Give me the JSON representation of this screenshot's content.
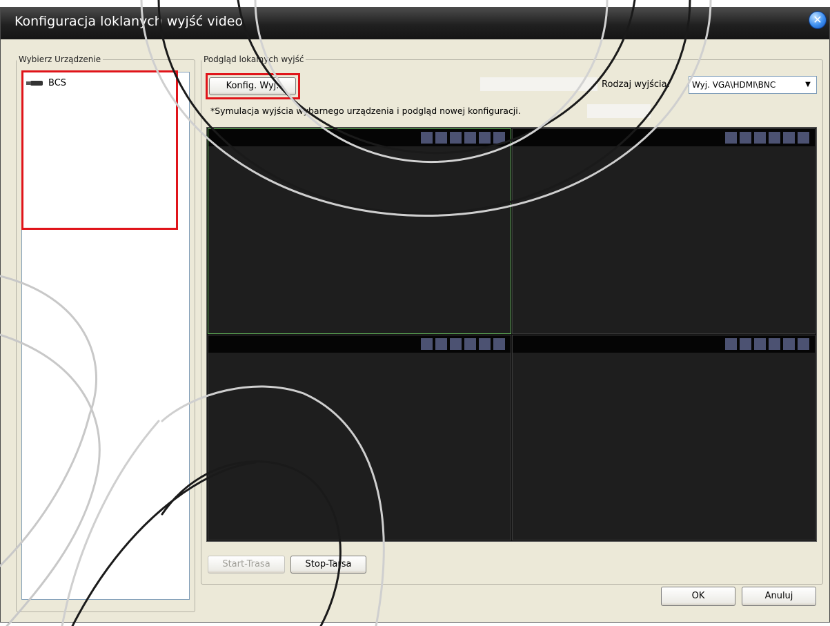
{
  "window": {
    "title": "Konfiguracja loklanych wyjść video",
    "close_icon": "close-icon"
  },
  "device_panel": {
    "legend": "Wybierz Urządzenie",
    "devices": [
      {
        "label": "BCS",
        "icon": "camera-icon"
      }
    ]
  },
  "preview_panel": {
    "legend": "Podgląd lokalnych wyjść",
    "config_button": "Konfig. Wyj.",
    "output_type_label": "Rodzaj wyjścia:",
    "output_type_value": "Wyj. VGA\\HDMI\\BNC",
    "note": "*Symulacja wyjścia wybarnego urządzenia i podgląd nowej konfiguracji.",
    "pane_count": 4,
    "pane_squares_per_bar": 6,
    "selected_pane": 1
  },
  "route_buttons": {
    "start": "Start-Trasa",
    "stop": "Stop-Tarsa"
  },
  "dialog_buttons": {
    "ok": "OK",
    "cancel": "Anuluj"
  },
  "colors": {
    "highlight": "#e0141a",
    "selected_pane_border": "#63b65a",
    "preview_square": "#4c5272"
  }
}
